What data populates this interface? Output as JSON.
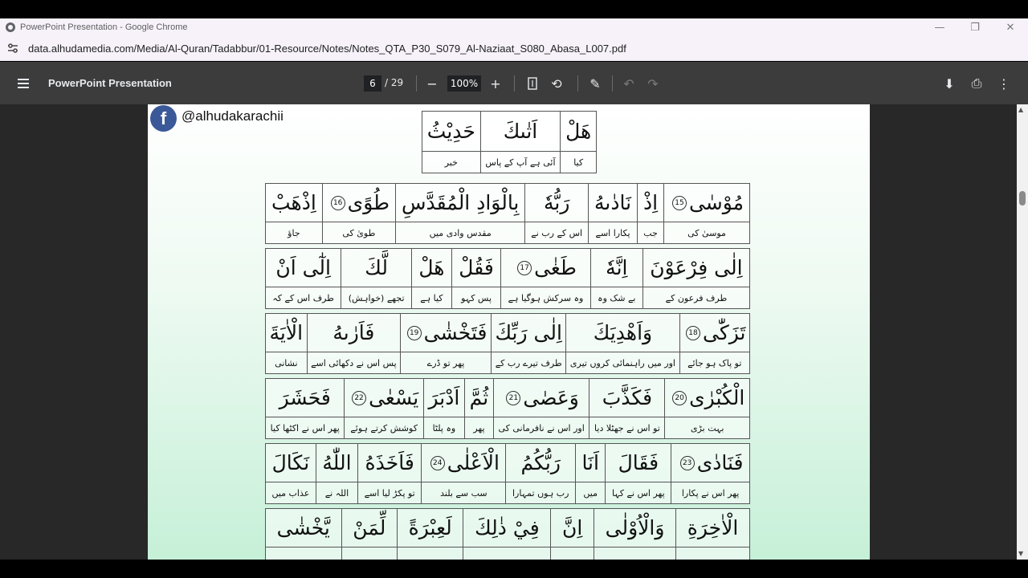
{
  "window": {
    "title": "PowerPoint Presentation - Google Chrome"
  },
  "address_bar": {
    "url": "data.alhudamedia.com/Media/Al-Quran/Tadabbur/01-Resource/Notes/Notes_QTA_P30_S079_Al-Naziaat_S080_Abasa_L007.pdf"
  },
  "pdf_toolbar": {
    "title": "PowerPoint Presentation",
    "page_current": "6",
    "page_total": "/ 29",
    "zoom": "100%"
  },
  "document": {
    "social_handle": "@alhudakarachii",
    "header_table": [
      {
        "ar": "هَلْ",
        "ur": "کیا"
      },
      {
        "ar": "اَتٰىكَ",
        "ur": "آئی ہے آپ کے پاس"
      },
      {
        "ar": "حَدِيْثُ",
        "ur": "خبر"
      }
    ],
    "rows": [
      [
        {
          "ar": "مُوْسٰى",
          "ayah": "15",
          "ur": "موسیٰ کی"
        },
        {
          "ar": "اِذْ",
          "ur": "جب"
        },
        {
          "ar": "نَادٰىهُ",
          "ur": "پکارا اسے"
        },
        {
          "ar": "رَبُّهٗ",
          "ur": "اس کے رب نے"
        },
        {
          "ar": "بِالْوَادِ الْمُقَدَّسِ",
          "ur": "مقدس وادی میں"
        },
        {
          "ar": "طُوًى",
          "ayah": "16",
          "ur": "طویٰ کی"
        },
        {
          "ar": "اِذْهَبْ",
          "ur": "جاؤ"
        }
      ],
      [
        {
          "ar": "اِلٰى فِرْعَوْنَ",
          "ur": "طرف فرعون کے"
        },
        {
          "ar": "اِنَّهٗ",
          "ur": "بے شک وہ"
        },
        {
          "ar": "طَغٰى",
          "ayah": "17",
          "ur": "وہ سرکش ہوگیا ہے"
        },
        {
          "ar": "فَقُلْ",
          "ur": "پس کہو"
        },
        {
          "ar": "هَلْ",
          "ur": "کیا ہے"
        },
        {
          "ar": "لَّكَ",
          "ur": "تجھے (خواہش)"
        },
        {
          "ar": "اِلٰٓى اَنْ",
          "ur": "طرف اس کے کہ"
        }
      ],
      [
        {
          "ar": "تَزَكّٰى",
          "ayah": "18",
          "ur": "تو پاک ہو جائے"
        },
        {
          "ar": "وَاَهْدِيَكَ",
          "ur": "اور میں راہنمائی کروں تیری"
        },
        {
          "ar": "اِلٰى رَبِّكَ",
          "ur": "طرف تیرے رب کے"
        },
        {
          "ar": "فَتَخْشٰى",
          "ayah": "19",
          "ur": "پھر تو ڈرے"
        },
        {
          "ar": "فَاَرٰىهُ",
          "ur": "پس اس نے دکھائی اسے"
        },
        {
          "ar": "الْاٰيَةَ",
          "ur": "نشانی"
        }
      ],
      [
        {
          "ar": "الْكُبْرٰى",
          "ayah": "20",
          "ur": "بہت بڑی"
        },
        {
          "ar": "فَكَذَّبَ",
          "ur": "تو اس نے جھٹلا دیا"
        },
        {
          "ar": "وَعَصٰى",
          "ayah": "21",
          "ur": "اور اس نے نافرمانی کی"
        },
        {
          "ar": "ثُمَّ",
          "ur": "پھر"
        },
        {
          "ar": "اَدْبَرَ",
          "ur": "وہ پلٹا"
        },
        {
          "ar": "يَسْعٰى",
          "ayah": "22",
          "ur": "کوشش کرتے ہوئے"
        },
        {
          "ar": "فَحَشَرَ",
          "ur": "پھر اس نے اکٹھا کیا"
        }
      ],
      [
        {
          "ar": "فَنَادٰى",
          "ayah": "23",
          "ur": "پھر اس نے پکارا"
        },
        {
          "ar": "فَقَالَ",
          "ur": "پھر اس نے کہا"
        },
        {
          "ar": "اَنَا",
          "ur": "میں"
        },
        {
          "ar": "رَبُّكُمُ",
          "ur": "رب ہوں تمہارا"
        },
        {
          "ar": "الْاَعْلٰى",
          "ayah": "24",
          "ur": "سب سے بلند"
        },
        {
          "ar": "فَاَخَذَهُ",
          "ur": "تو پکڑ لیا اسے"
        },
        {
          "ar": "اللّٰهُ",
          "ur": "اللہ نے"
        },
        {
          "ar": "نَكَالَ",
          "ur": "عذاب میں"
        }
      ],
      [
        {
          "ar": "الْاٰخِرَةِ",
          "ur": ""
        },
        {
          "ar": "وَالْاُوْلٰى",
          "ur": ""
        },
        {
          "ar": "اِنَّ",
          "ur": ""
        },
        {
          "ar": "فِيْ ذٰلِكَ",
          "ur": ""
        },
        {
          "ar": "لَعِبْرَةً",
          "ur": ""
        },
        {
          "ar": "لِّمَنْ",
          "ur": ""
        },
        {
          "ar": "يَّخْشٰى",
          "ur": ""
        }
      ]
    ]
  }
}
